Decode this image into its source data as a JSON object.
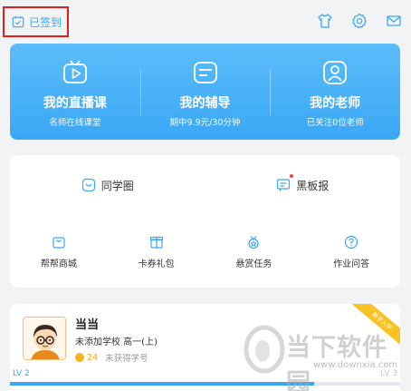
{
  "header": {
    "checkin_label": "已签到",
    "icons": [
      "calendar-check-icon",
      "tshirt-icon",
      "gear-icon",
      "mail-icon"
    ]
  },
  "featured": [
    {
      "title": "我的直播课",
      "subtitle": "名师在线课堂",
      "icon": "play-tv-icon"
    },
    {
      "title": "我的辅导",
      "subtitle": "期中9.9元/30分钟",
      "icon": "tutor-chat-icon"
    },
    {
      "title": "我的老师",
      "subtitle": "已关注0位老师",
      "icon": "teacher-person-icon"
    }
  ],
  "menu": {
    "row1": [
      {
        "label": "同学圈",
        "icon": "classmate-circle-icon",
        "dot": false
      },
      {
        "label": "黑板报",
        "icon": "blackboard-icon",
        "dot": true
      }
    ],
    "row2": [
      {
        "label": "帮帮商城",
        "icon": "shop-bag-icon"
      },
      {
        "label": "卡券礼包",
        "icon": "gift-box-icon"
      },
      {
        "label": "悬赏任务",
        "icon": "reward-medal-icon"
      },
      {
        "label": "作业问答",
        "icon": "question-icon"
      }
    ]
  },
  "profile": {
    "name": "当当",
    "school": "未添加学校 高一(上)",
    "coins": "24",
    "student_id": "未获得学号",
    "ribbon": "新手入学",
    "level_current": "LV 2",
    "level_next": "LV 3",
    "progress": 0.78
  },
  "watermark": {
    "text": "当下软件园",
    "url": "www.downxia.com"
  },
  "colors": {
    "accent": "#3aa7f5",
    "highlight_box": "#e02020",
    "coin": "#f5a623",
    "ribbon": "#f7c325"
  }
}
